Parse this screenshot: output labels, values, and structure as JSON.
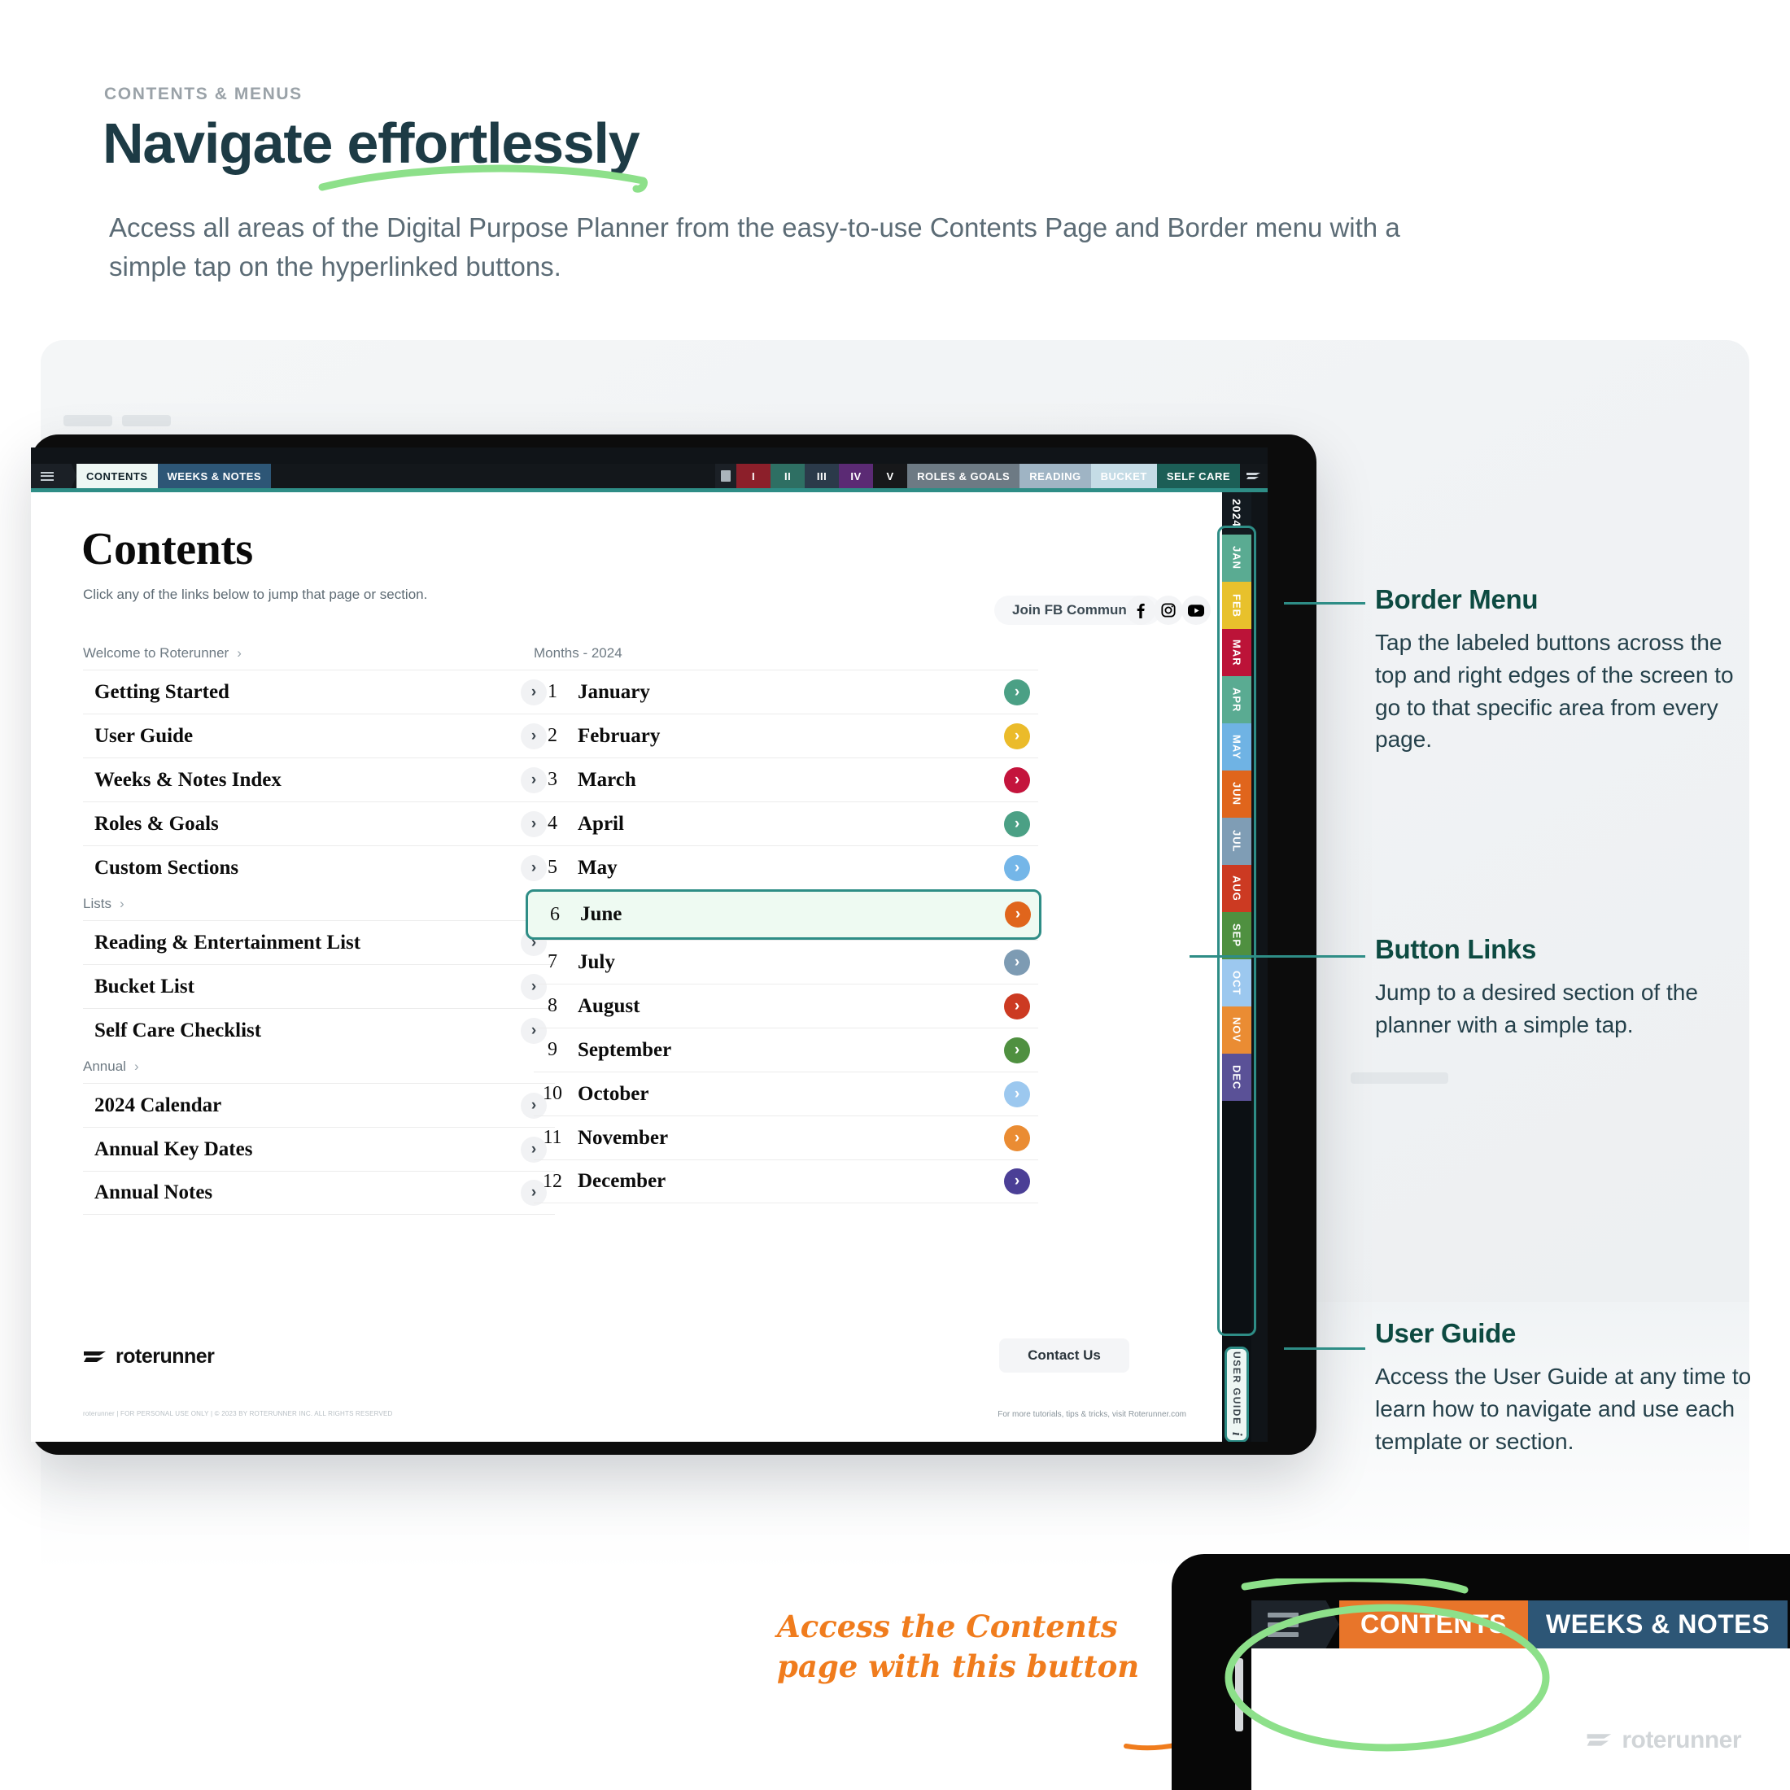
{
  "header": {
    "eyebrow": "CONTENTS & MENUS",
    "headline": "Navigate effortlessly",
    "subtitle": "Access all areas of the Digital Purpose Planner from the easy-to-use Contents Page and Border menu with a simple tap on the hyperlinked buttons."
  },
  "toolbar": {
    "contents": "CONTENTS",
    "weeks_notes": "WEEKS & NOTES",
    "numerals": [
      {
        "label": "I",
        "color": "#8c1f2a"
      },
      {
        "label": "II",
        "color": "#2e6f63"
      },
      {
        "label": "III",
        "color": "#2b3a4a"
      },
      {
        "label": "IV",
        "color": "#5b2a74"
      },
      {
        "label": "V",
        "color": "#17181a"
      }
    ],
    "sections": [
      {
        "label": "ROLES & GOALS",
        "bg": "#6d7a84",
        "fg": "#ffffff"
      },
      {
        "label": "READING",
        "bg": "#9fb4c4",
        "fg": "#ffffff"
      },
      {
        "label": "BUCKET",
        "bg": "#c5dce6",
        "fg": "#ffffff"
      },
      {
        "label": "SELF CARE",
        "bg": "#1c5e56",
        "fg": "#ffffff"
      }
    ]
  },
  "contents_page": {
    "title": "Contents",
    "subtitle": "Click any of the links below to jump that page or section.",
    "fb_button": "Join FB Community",
    "social": [
      "facebook-icon",
      "instagram-icon",
      "youtube-icon"
    ],
    "left_groups": [
      {
        "heading": "Welcome to Roterunner",
        "items": [
          "Getting Started",
          "User Guide",
          "Weeks & Notes Index",
          "Roles & Goals",
          "Custom Sections"
        ]
      },
      {
        "heading": "Lists",
        "items": [
          "Reading & Entertainment List",
          "Bucket List",
          "Self Care Checklist"
        ]
      },
      {
        "heading": "Annual",
        "items": [
          "2024 Calendar",
          "Annual Key Dates",
          "Annual Notes"
        ]
      }
    ],
    "months_heading": "Months - 2024",
    "months": [
      {
        "index": "1",
        "name": "January",
        "color": "#4ba085",
        "highlight": false
      },
      {
        "index": "2",
        "name": "February",
        "color": "#ebbb2a",
        "highlight": false
      },
      {
        "index": "3",
        "name": "March",
        "color": "#c4143c",
        "highlight": false
      },
      {
        "index": "4",
        "name": "April",
        "color": "#4ba085",
        "highlight": false
      },
      {
        "index": "5",
        "name": "May",
        "color": "#74b6e8",
        "highlight": false
      },
      {
        "index": "6",
        "name": "June",
        "color": "#e0651c",
        "highlight": true
      },
      {
        "index": "7",
        "name": "July",
        "color": "#7d9bb3",
        "highlight": false
      },
      {
        "index": "8",
        "name": "August",
        "color": "#cc3a22",
        "highlight": false
      },
      {
        "index": "9",
        "name": "September",
        "color": "#4f9040",
        "highlight": false
      },
      {
        "index": "10",
        "name": "October",
        "color": "#9cc8ef",
        "highlight": false
      },
      {
        "index": "11",
        "name": "November",
        "color": "#ea8c33",
        "highlight": false
      },
      {
        "index": "12",
        "name": "December",
        "color": "#4b3f96",
        "highlight": false
      }
    ],
    "chevron_glyph": "›",
    "logo_text": "roterunner",
    "contact_button": "Contact Us",
    "fine_print_left": "roterunner  |  FOR PERSONAL USE ONLY  |  © 2023 BY ROTERUNNER INC. ALL RIGHTS RESERVED",
    "fine_print_right": "For more tutorials, tips & tricks, visit Roterunner.com"
  },
  "border_menu": {
    "year": "2024",
    "tabs": [
      {
        "label": "JAN",
        "color": "#5aab92"
      },
      {
        "label": "FEB",
        "color": "#e8c12c"
      },
      {
        "label": "MAR",
        "color": "#bc1338"
      },
      {
        "label": "APR",
        "color": "#5aab92"
      },
      {
        "label": "MAY",
        "color": "#6fb3e4"
      },
      {
        "label": "JUN",
        "color": "#e0651c"
      },
      {
        "label": "JUL",
        "color": "#7f9db5"
      },
      {
        "label": "AUG",
        "color": "#cc3a22"
      },
      {
        "label": "SEP",
        "color": "#4f9040"
      },
      {
        "label": "OCT",
        "color": "#9cc8ef"
      },
      {
        "label": "NOV",
        "color": "#ea8c33"
      },
      {
        "label": "DEC",
        "color": "#5a5197"
      }
    ],
    "user_guide_tab": "USER GUIDE",
    "user_guide_icon": "i"
  },
  "annotations": [
    {
      "title": "Border Menu",
      "body": "Tap the labeled buttons across the top and right edges of the screen to go to that specific area from every page."
    },
    {
      "title": "Button Links",
      "body": "Jump to a desired section of the planner with a simple tap."
    },
    {
      "title": "User Guide",
      "body": "Access the User Guide at any time to learn how to navigate and use each template or section."
    }
  ],
  "callout": {
    "handwriting": "Access the Contents page with this button"
  },
  "inset": {
    "contents": "CONTENTS",
    "weeks_notes": "WEEKS & NOTES",
    "logo_text": "roterunner"
  },
  "colors": {
    "teal": "#2e8d86",
    "dark_teal": "#0d4a41",
    "orange": "#e8752a",
    "green_highlight": "#8de08a",
    "navy": "#1d3b45"
  }
}
